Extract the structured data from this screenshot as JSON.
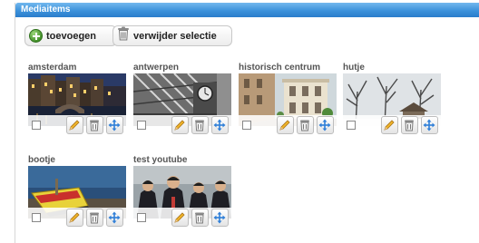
{
  "panel": {
    "title": "Mediaitems"
  },
  "toolbar": {
    "add_label": "toevoegen",
    "delete_label": "verwijder selectie"
  },
  "items": [
    {
      "title": "amsterdam"
    },
    {
      "title": "antwerpen"
    },
    {
      "title": "historisch centrum"
    },
    {
      "title": "hutje"
    },
    {
      "title": "bootje"
    },
    {
      "title": "test youtube"
    }
  ],
  "colors": {
    "header": "#3c92db",
    "edit": "#f0b429",
    "move": "#2f7fd8"
  }
}
